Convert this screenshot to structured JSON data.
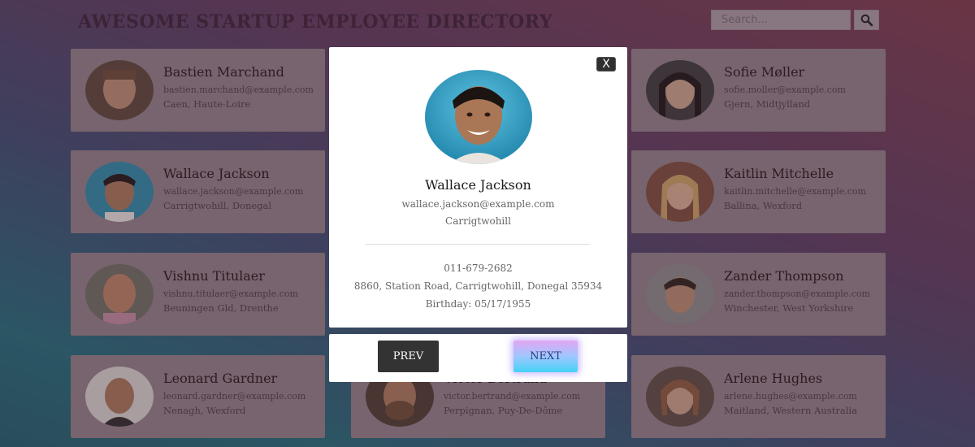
{
  "header": {
    "title": "AWESOME STARTUP EMPLOYEE DIRECTORY",
    "search_placeholder": "Search..."
  },
  "employees": [
    {
      "name": "Bastien Marchand",
      "email": "bastien.marchand@example.com",
      "location": "Caen, Haute-Loire"
    },
    {
      "name": "Sofie Møller",
      "email": "sofie.moller@example.com",
      "location": "Gjern, Midtjylland"
    },
    {
      "name": "Wallace Jackson",
      "email": "wallace.jackson@example.com",
      "location": "Carrigtwohill, Donegal"
    },
    {
      "name": "Kaitlin Mitchelle",
      "email": "kaitlin.mitchelle@example.com",
      "location": "Ballina, Wexford"
    },
    {
      "name": "Vishnu Titulaer",
      "email": "vishnu.titulaer@example.com",
      "location": "Beuningen Gld, Drenthe"
    },
    {
      "name": "Zander Thompson",
      "email": "zander.thompson@example.com",
      "location": "Winchester, West Yorkshire"
    },
    {
      "name": "Leonard Gardner",
      "email": "leonard.gardner@example.com",
      "location": "Nenagh, Wexford"
    },
    {
      "name": "Victor Bertrand",
      "email": "victor.bertrand@example.com",
      "location": "Perpignan, Puy-De-Dôme"
    },
    {
      "name": "Arlene Hughes",
      "email": "arlene.hughes@example.com",
      "location": "Maitland, Western Australia"
    }
  ],
  "modal": {
    "close_label": "X",
    "name": "Wallace Jackson",
    "email": "wallace.jackson@example.com",
    "city": "Carrigtwohill",
    "phone": "011-679-2682",
    "address": "8860, Station Road, Carrigtwohill, Donegal 35934",
    "birthday": "Birthday: 05/17/1955",
    "prev_label": "PREV",
    "next_label": "NEXT"
  }
}
